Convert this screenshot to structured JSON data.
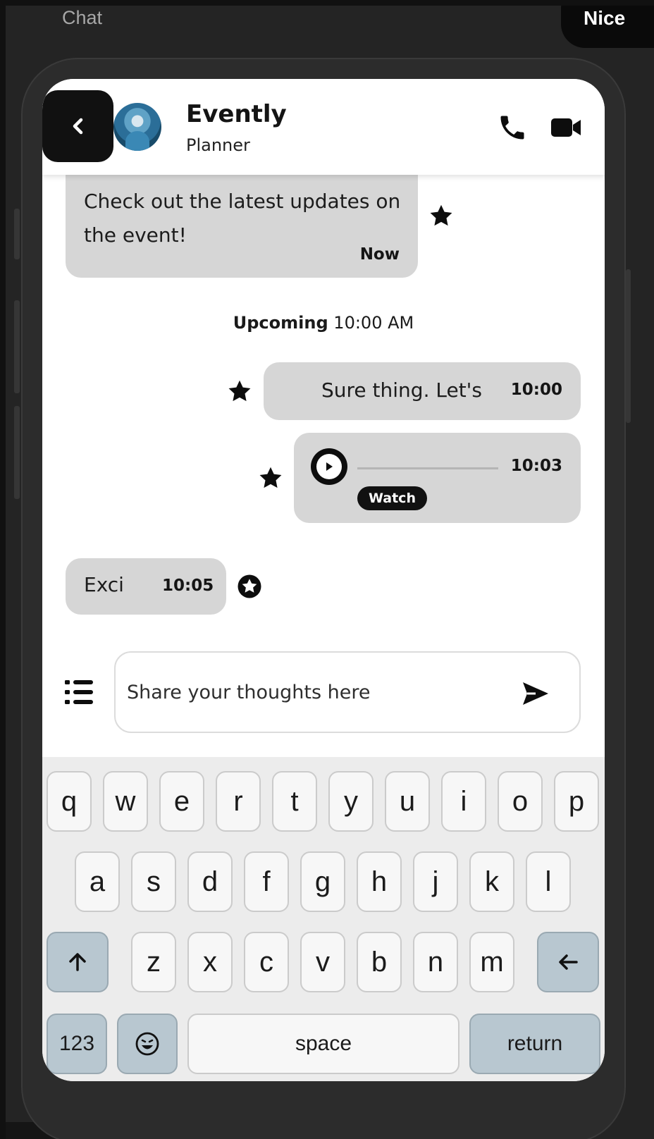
{
  "background": {
    "top_label": "Chat",
    "top_pill": "Nice"
  },
  "header": {
    "title": "Evently",
    "subtitle": "Planner"
  },
  "messages": [
    {
      "text": "Check out the latest updates on the event!",
      "time": "Now",
      "starred": true
    },
    {
      "text": "Sure thing. Let's",
      "time": "10:00",
      "starred": true
    },
    {
      "type": "audio",
      "time": "10:03",
      "badge": "Watch",
      "starred": true
    },
    {
      "text": "Exci",
      "time": "10:05",
      "starred": false
    }
  ],
  "separator": {
    "label": "Upcoming",
    "time": "10:00 AM"
  },
  "composer": {
    "placeholder": "Share your thoughts here"
  },
  "keyboard": {
    "row1": [
      "q",
      "w",
      "e",
      "r",
      "t",
      "y",
      "u",
      "i",
      "o",
      "p"
    ],
    "row2": [
      "a",
      "s",
      "d",
      "f",
      "g",
      "h",
      "j",
      "k",
      "l"
    ],
    "row3": [
      "z",
      "x",
      "c",
      "v",
      "b",
      "n",
      "m"
    ],
    "numbers": "123",
    "space": "space",
    "return": "return"
  },
  "colors": {
    "bubble": "#d6d6d6",
    "dark": "#111111",
    "accent_key": "#b8c7d0"
  },
  "icons": [
    "back-icon",
    "phone-icon",
    "video-icon",
    "star-icon",
    "star-outline-icon",
    "play-icon",
    "list-icon",
    "send-icon",
    "shift-icon",
    "backspace-icon",
    "emoji-icon"
  ]
}
